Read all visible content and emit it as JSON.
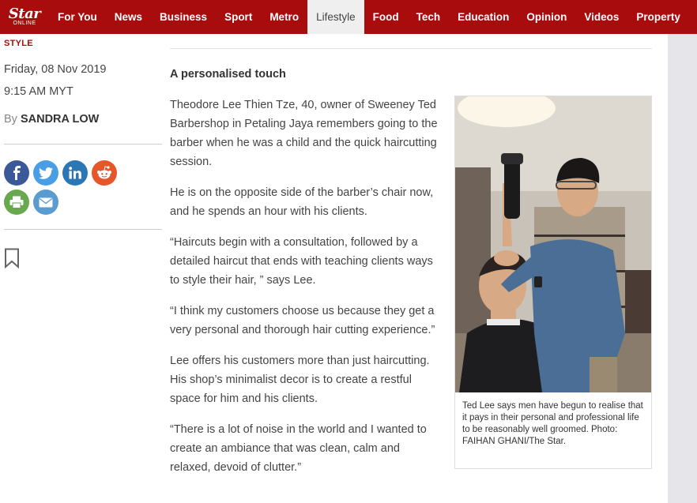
{
  "site": {
    "logo_main": "Star",
    "logo_sub": "ONLINE"
  },
  "nav": {
    "items": [
      "For You",
      "News",
      "Business",
      "Sport",
      "Metro",
      "Lifestyle",
      "Food",
      "Tech",
      "Education",
      "Opinion",
      "Videos",
      "Property"
    ],
    "active": "Lifestyle"
  },
  "meta": {
    "section": "STYLE",
    "date": "Friday, 08 Nov 2019",
    "time": "9:15 AM MYT",
    "by_prefix": "By",
    "author": "SANDRA LOW"
  },
  "share_icons": [
    {
      "name": "facebook-icon",
      "color": "#3b5998"
    },
    {
      "name": "twitter-icon",
      "color": "#4a9ee5"
    },
    {
      "name": "linkedin-icon",
      "color": "#2b76b5"
    },
    {
      "name": "reddit-icon",
      "color": "#e5562b"
    },
    {
      "name": "print-icon",
      "color": "#6aa84f"
    },
    {
      "name": "email-icon",
      "color": "#5a9bd0"
    }
  ],
  "article": {
    "subhead": "A personalised touch",
    "paragraphs": [
      "Theodore Lee Thien Tze, 40, owner of Sweeney Ted Barbershop in Petaling Jaya remembers going to the barber when he was a child and the quick haircutting session.",
      "He is on the opposite side of the barber’s chair now, and he spends an hour with his clients.",
      "“Haircuts begin with a consultation, followed by a detailed haircut that ends with teaching clients ways to style their hair, ” says Lee.",
      "“I think my customers choose us because they get a very personal and thorough hair cutting experience.”",
      "Lee offers his customers more than just haircutting. His shop’s minimalist decor is to create a restful space for him and his clients.",
      "“There is a lot of noise in the world and I wanted to create an ambiance that was clean, calm and relaxed, devoid of clutter.”"
    ]
  },
  "figure": {
    "caption": "Ted Lee says men have begun to realise that it pays in their personal and professional life to be reasonably well groomed. Photo: FAIHAN GHANI/The Star."
  },
  "colors": {
    "brand_red": "#a80c0c",
    "nav_active_bg": "#efefef"
  }
}
